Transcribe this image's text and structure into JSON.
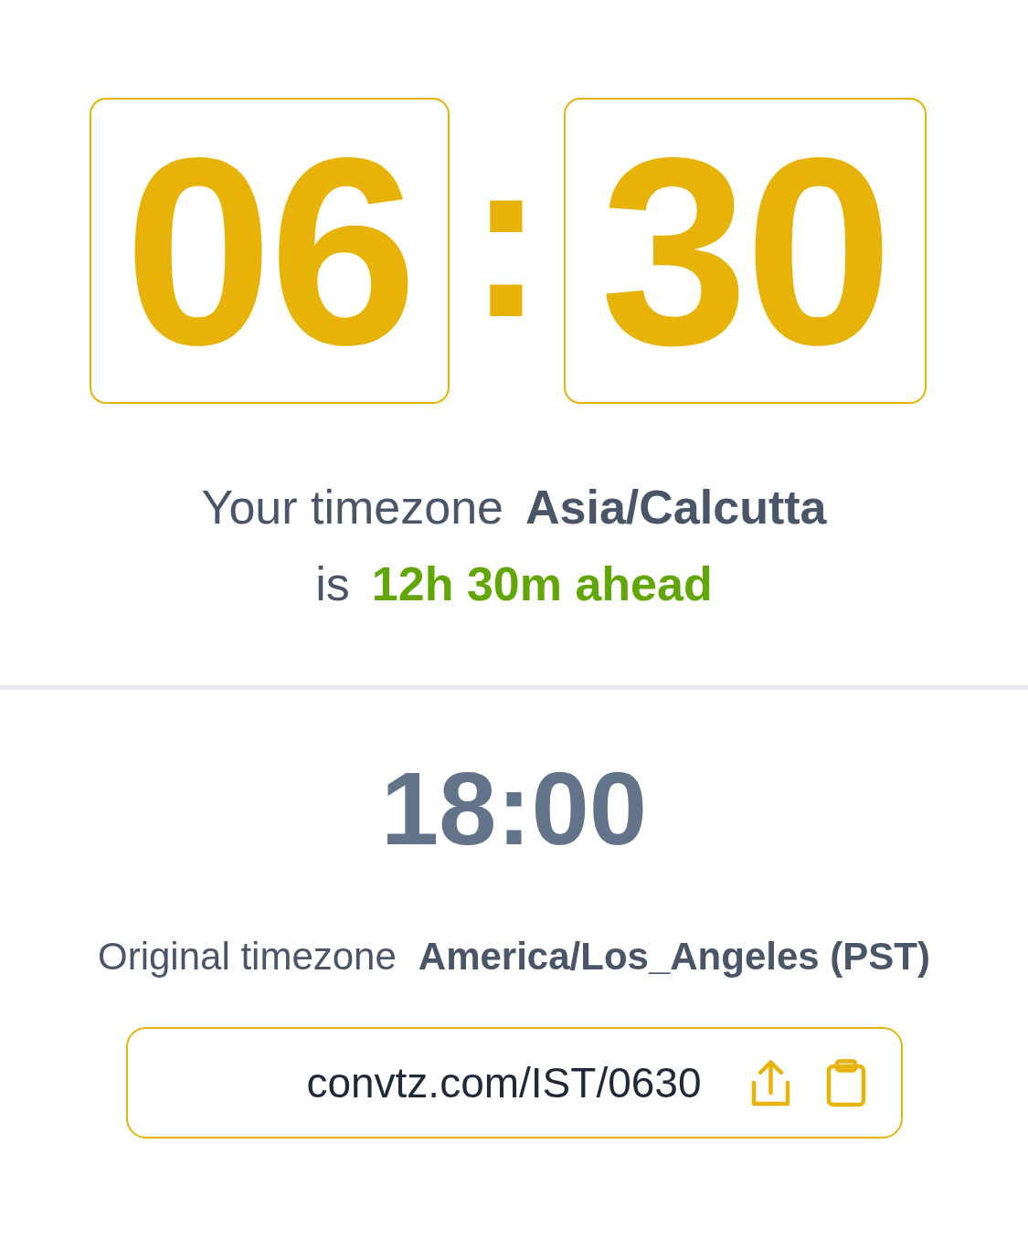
{
  "converted_time": {
    "hours": "06",
    "separator": ":",
    "minutes": "30"
  },
  "your_timezone": {
    "label": "Your timezone",
    "name": "Asia/Calcutta",
    "connector": "is",
    "offset": "12h 30m ahead"
  },
  "original_time": "18:00",
  "original_timezone": {
    "label": "Original timezone",
    "name": "America/Los_Angeles (PST)"
  },
  "share_link": {
    "url": "convtz.com/IST/0630"
  }
}
